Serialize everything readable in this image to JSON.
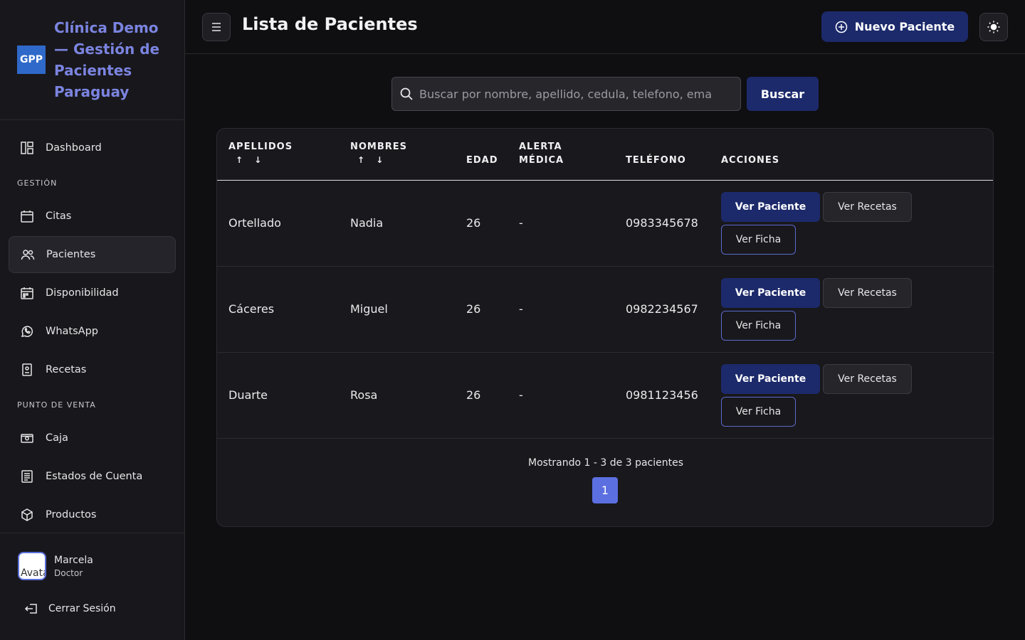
{
  "brand": {
    "logo": "GPP",
    "title": "Clínica Demo — Gestión de Pacientes Paraguay"
  },
  "nav": {
    "dashboard": "Dashboard",
    "section_gestion": "GESTIÓN",
    "citas": "Citas",
    "pacientes": "Pacientes",
    "disponibilidad": "Disponibilidad",
    "whatsapp": "WhatsApp",
    "recetas": "Recetas",
    "section_pos": "PUNTO DE VENTA",
    "caja": "Caja",
    "estados": "Estados de Cuenta",
    "productos": "Productos"
  },
  "user": {
    "avatar_alt": "Avatar",
    "name": "Marcela",
    "role": "Doctor",
    "logout": "Cerrar Sesión"
  },
  "header": {
    "title": "Lista de Pacientes",
    "new_patient": "Nuevo Paciente"
  },
  "search": {
    "placeholder": "Buscar por nombre, apellido, cedula, telefono, ema",
    "button": "Buscar"
  },
  "table": {
    "headers": {
      "apellidos": "APELLIDOS",
      "nombres": "NOMBRES",
      "sort": "↑ ↓",
      "edad": "EDAD",
      "alerta_1": "ALERTA",
      "alerta_2": "MÉDICA",
      "telefono": "TELÉFONO",
      "acciones": "ACCIONES"
    },
    "actions": {
      "ver_paciente": "Ver Paciente",
      "ver_recetas": "Ver Recetas",
      "ver_ficha": "Ver Ficha"
    },
    "rows": [
      {
        "apellido": "Ortellado",
        "nombre": "Nadia",
        "edad": "26",
        "alerta": "-",
        "telefono": "0983345678"
      },
      {
        "apellido": "Cáceres",
        "nombre": "Miguel",
        "edad": "26",
        "alerta": "-",
        "telefono": "0982234567"
      },
      {
        "apellido": "Duarte",
        "nombre": "Rosa",
        "edad": "26",
        "alerta": "-",
        "telefono": "0981123456"
      }
    ],
    "footer": "Mostrando 1 - 3 de 3 pacientes",
    "page": "1"
  },
  "colors": {
    "primary": "#1c2a6b",
    "accent": "#7b84e0",
    "page_active": "#5b6fe0"
  }
}
